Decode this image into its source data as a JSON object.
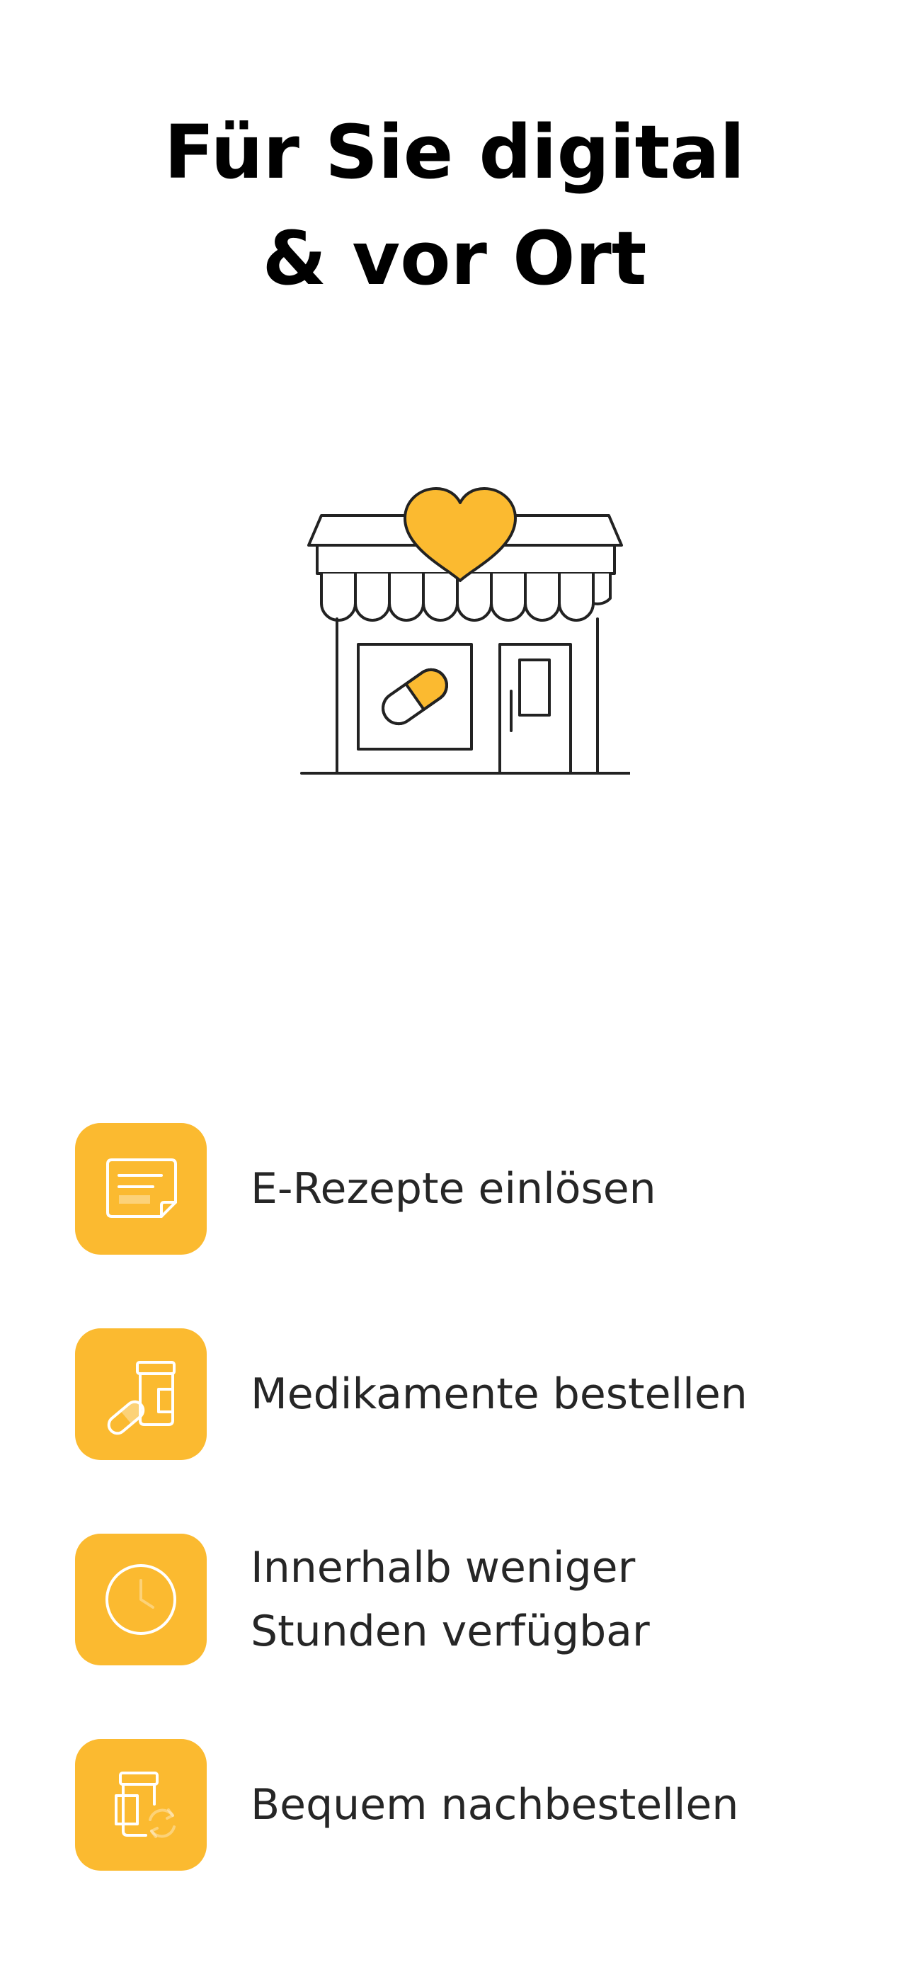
{
  "header": {
    "title_line1": "Für Sie digital",
    "title_line2": "& vor Ort"
  },
  "hero": {
    "icon": "pharmacy-storefront-heart-icon",
    "colors": {
      "accent": "#fbba30",
      "outline": "#222222"
    }
  },
  "features": [
    {
      "icon": "prescription-document-icon",
      "line1": "E-Rezepte einlösen",
      "line2": ""
    },
    {
      "icon": "medication-pill-bottle-icon",
      "line1": "Medikamente bestellen",
      "line2": ""
    },
    {
      "icon": "clock-icon",
      "line1": "Innerhalb weniger",
      "line2": "Stunden verfügbar"
    },
    {
      "icon": "reorder-refresh-icon",
      "line1": "Bequem nachbestellen",
      "line2": ""
    }
  ],
  "colors": {
    "accent": "#fbba30",
    "text": "#262626",
    "title": "#000000",
    "background": "#ffffff"
  }
}
